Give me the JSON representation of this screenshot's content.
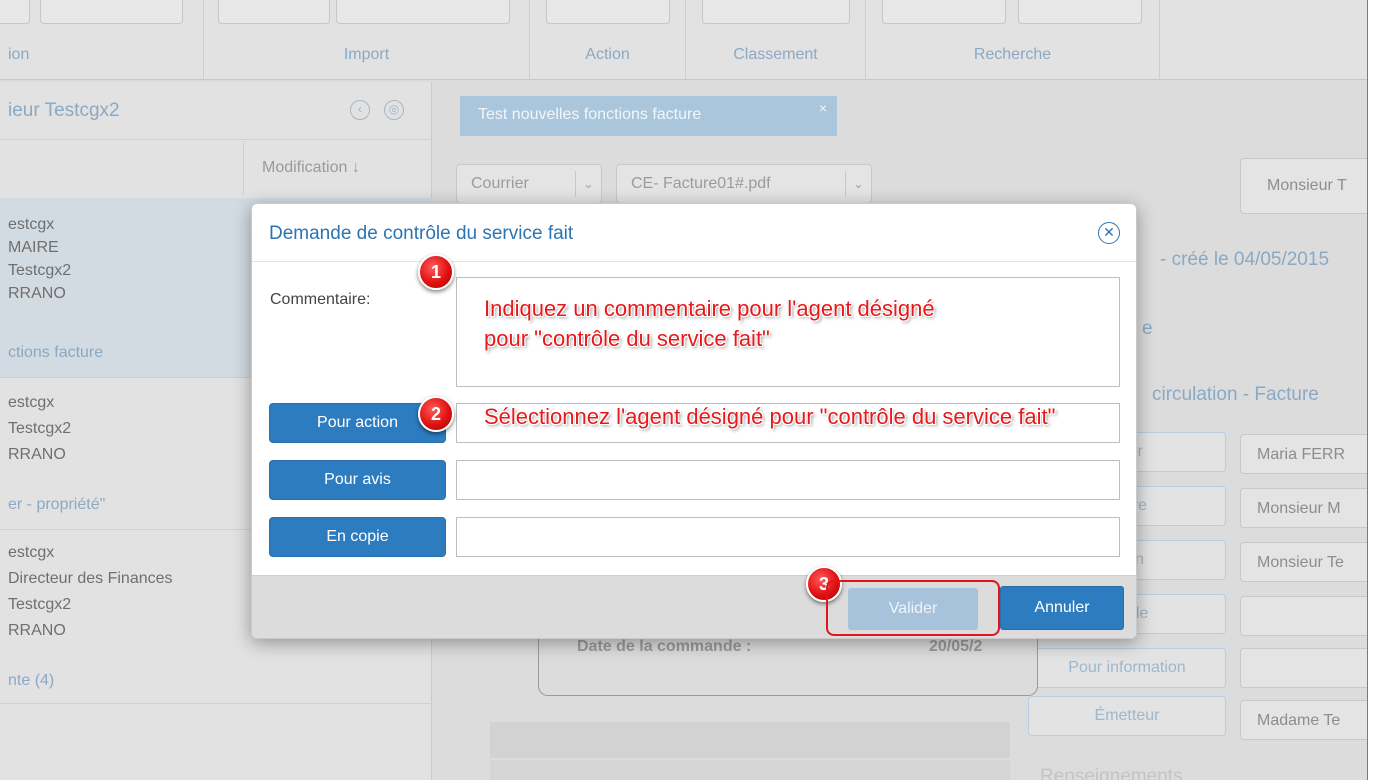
{
  "toolbar": {
    "groups": [
      "ion",
      "Import",
      "Action",
      "Classement",
      "Recherche"
    ]
  },
  "left_panel": {
    "title": "ieur Testcgx2",
    "sort_label": "Modification ↓",
    "items": [
      {
        "lines": [
          "estcgx",
          "MAIRE",
          "Testcgx2",
          "RRANO"
        ],
        "link": "ctions facture"
      },
      {
        "lines": [
          "estcgx",
          "Testcgx2",
          "RRANO"
        ],
        "link": "er - propriété\""
      },
      {
        "lines": [
          "estcgx",
          "Directeur des Finances",
          "Testcgx2",
          "RRANO"
        ],
        "link": "nte (4)"
      }
    ]
  },
  "main": {
    "tab_label": "Test nouvelles fonctions facture",
    "tab_close": "×",
    "doc_type": "Courrier",
    "doc_file": "CE- Facture01#.pdf",
    "recipient": "Monsieur T",
    "created": "- créé le 04/05/2015",
    "frag_e": "e",
    "circulation": "circulation - Facture",
    "roles": [
      {
        "label": "tteur",
        "value": "Maria FERR"
      },
      {
        "label": "ataire",
        "value": "Monsieur M"
      },
      {
        "label": "ction",
        "value": "Monsieur Te"
      },
      {
        "label": "alable",
        "value": ""
      },
      {
        "label": "Pour information",
        "value": ""
      },
      {
        "label": "Émetteur",
        "value": "Madame Te"
      }
    ],
    "card_text": "Date de la commande :",
    "card_value": "20/05/2",
    "footer_text": "Renseignements"
  },
  "modal": {
    "title": "Demande de contrôle du service fait",
    "comment_label": "Commentaire:",
    "buttons": {
      "pour_action": "Pour action",
      "pour_avis": "Pour avis",
      "en_copie": "En copie"
    },
    "valider": "Valider",
    "annuler": "Annuler"
  },
  "annotations": {
    "m1": "1",
    "m2": "2",
    "m3": "3",
    "text1_line1": "Indiquez un commentaire pour l'agent désigné",
    "text1_line2": "pour \"contrôle du service fait\"",
    "text2": "Sélectionnez l'agent désigné pour \"contrôle du service fait\""
  },
  "colors": {
    "accent": "#2d7cc0",
    "annotation": "#e8191b"
  }
}
